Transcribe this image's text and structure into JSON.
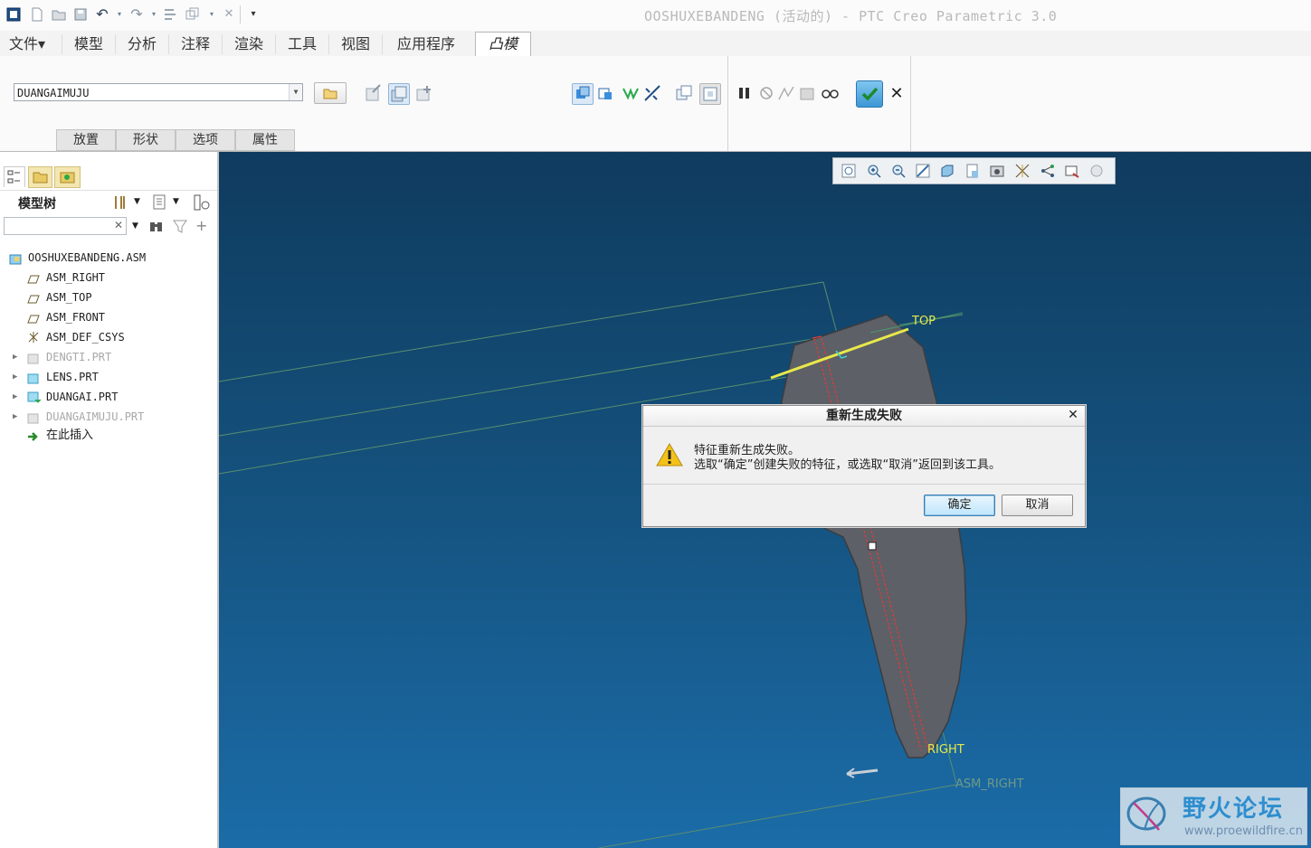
{
  "window": {
    "title": "OOSHUXEBANDENG (活动的) - PTC Creo Parametric 3.0"
  },
  "menu_tabs": [
    "文件▾",
    "模型",
    "分析",
    "注释",
    "渲染",
    "工具",
    "视图",
    "应用程序"
  ],
  "active_tab": "凸模",
  "ribbon": {
    "part_combo_value": "DUANGAIMUJU",
    "subtabs": [
      "放置",
      "形状",
      "选项",
      "属性"
    ]
  },
  "model_tree": {
    "title": "模型树",
    "search_value": "",
    "items": [
      {
        "label": "OOSHUXEBANDENG.ASM",
        "icon": "assembly-icon",
        "expandable": false,
        "dimmed": false
      },
      {
        "label": "ASM_RIGHT",
        "icon": "datum-plane-icon",
        "expandable": false,
        "dimmed": false
      },
      {
        "label": "ASM_TOP",
        "icon": "datum-plane-icon",
        "expandable": false,
        "dimmed": false
      },
      {
        "label": "ASM_FRONT",
        "icon": "datum-plane-icon",
        "expandable": false,
        "dimmed": false
      },
      {
        "label": "ASM_DEF_CSYS",
        "icon": "csys-icon",
        "expandable": false,
        "dimmed": false
      },
      {
        "label": "DENGTI.PRT",
        "icon": "part-icon",
        "expandable": true,
        "dimmed": true
      },
      {
        "label": "LENS.PRT",
        "icon": "part-icon",
        "expandable": true,
        "dimmed": false
      },
      {
        "label": "DUANGAI.PRT",
        "icon": "part-active-icon",
        "expandable": true,
        "dimmed": false
      },
      {
        "label": "DUANGAIMUJU.PRT",
        "icon": "part-icon",
        "expandable": true,
        "dimmed": true
      },
      {
        "label": "在此插入",
        "icon": "insert-arrow-icon",
        "expandable": false,
        "dimmed": false
      }
    ]
  },
  "viewport": {
    "labels": {
      "top": "TOP",
      "right": "RIGHT",
      "asm_right": "ASM_RIGHT"
    }
  },
  "dialog": {
    "title": "重新生成失败",
    "message_line1": "特征重新生成失败。",
    "message_line2": "选取“确定”创建失败的特征，或选取“取消”返回到该工具。",
    "ok_label": "确定",
    "cancel_label": "取消"
  },
  "watermark": {
    "name": "野火论坛",
    "url": "www.proewildfire.cn"
  },
  "colors": {
    "viewport_top": "#0f3b5e",
    "viewport_bottom": "#1b6ca8",
    "datum_label": "#e8e84a",
    "accent_green": "#2aa84a"
  }
}
